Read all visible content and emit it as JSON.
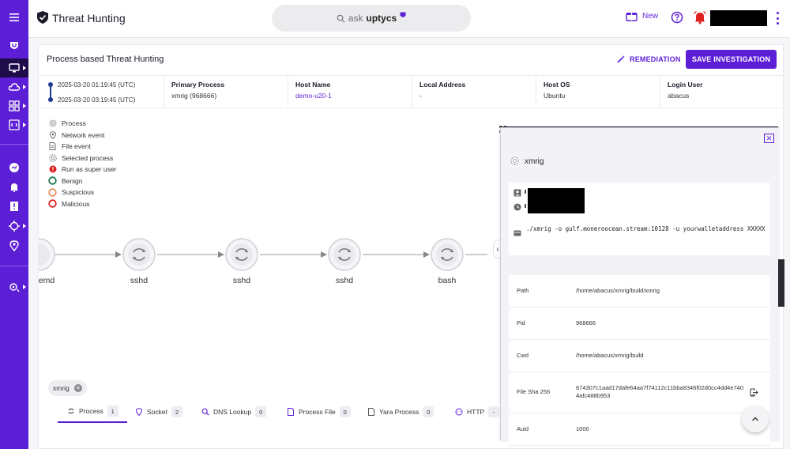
{
  "header": {
    "title": "Threat Hunting",
    "search": {
      "prefix": "ask",
      "brand": "uptycs"
    },
    "new_label": "New"
  },
  "sidebar": {
    "items": [
      "menu",
      "uptycs-logo",
      "monitor",
      "cloud",
      "apps",
      "code",
      "dashboard",
      "alerts",
      "detections",
      "investigations",
      "location",
      "settings"
    ]
  },
  "page": {
    "card_title": "Process based Threat Hunting",
    "remediation_label": "REMEDIATION",
    "save_label": "SAVE INVESTIGATION"
  },
  "info": {
    "time_start": "2025-03-20 01:19:45 (UTC)",
    "time_end": "2025-03-20 03:19:45 (UTC)",
    "columns": [
      {
        "label": "Primary Process",
        "value": "xmrig (968666)"
      },
      {
        "label": "Host Name",
        "value": "demo-u20-1"
      },
      {
        "label": "Local Address",
        "value": "-"
      },
      {
        "label": "Host OS",
        "value": "Ubuntu"
      },
      {
        "label": "Login User",
        "value": "abacus"
      }
    ]
  },
  "legend": [
    {
      "label": "Process",
      "icon": "process-icon"
    },
    {
      "label": "Network event",
      "icon": "network-icon"
    },
    {
      "label": "File event",
      "icon": "file-icon"
    },
    {
      "label": "Selected process",
      "icon": "selected-process-icon"
    },
    {
      "label": "Run as super user",
      "icon": "superuser-icon",
      "color": "#e02020"
    },
    {
      "label": "Benign",
      "icon": "benign-ring",
      "color": "#1a7a4c"
    },
    {
      "label": "Suspicious",
      "icon": "suspicious-ring",
      "color": "#e58f5a"
    },
    {
      "label": "Malicious",
      "icon": "malicious-ring",
      "color": "#e02020"
    }
  ],
  "graph": {
    "nodes": [
      "emd",
      "sshd",
      "sshd",
      "sshd",
      "bash"
    ]
  },
  "filter_chip": "xmrig",
  "tabs": [
    {
      "label": "Process",
      "count": "1"
    },
    {
      "label": "Socket",
      "count": "2"
    },
    {
      "label": "DNS Lookup",
      "count": "0"
    },
    {
      "label": "Process File",
      "count": "0"
    },
    {
      "label": "Yara Process",
      "count": "0"
    },
    {
      "label": "HTTP",
      "count": "-"
    }
  ],
  "panel": {
    "process_name": "xmrig",
    "command": "./xmrig -o gulf.moneroocean.stream:10128 -u yourwalletaddress XXXXX",
    "properties": [
      {
        "key": "Path",
        "value": "/home/abacus/xmrig/build/xmrig"
      },
      {
        "key": "Pid",
        "value": "968666"
      },
      {
        "key": "Cwd",
        "value": "/home/abacus/xmrig/build"
      },
      {
        "key": "File Sha 256",
        "value": "674307c1aad17dafe64aa7f74112c11bba8346f02d0cc4dd4e7404afc488b953"
      },
      {
        "key": "Auid",
        "value": "1000"
      }
    ]
  },
  "colors": {
    "accent": "#5d1fd6",
    "sidebar": "#5d1fd6",
    "alert": "#e02020"
  }
}
